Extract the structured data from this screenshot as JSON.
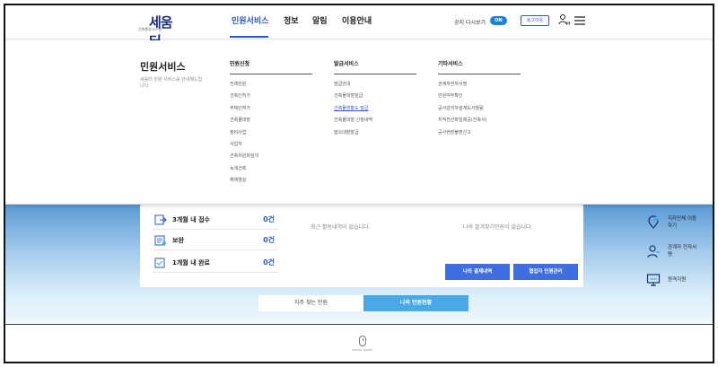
{
  "header": {
    "logo_text": "세움터",
    "logo_sub": "건축행정시스템",
    "nav": [
      {
        "label": "민원서비스",
        "active": true
      },
      {
        "label": "정보",
        "active": false
      },
      {
        "label": "알림",
        "active": false
      },
      {
        "label": "이용안내",
        "active": false
      }
    ],
    "notice_label": "공지 다시보기",
    "notice_toggle": "ON",
    "login_label": "로그아웃",
    "accent_color": "#2b57c7"
  },
  "mega": {
    "title": "민원서비스",
    "desc": "세움터 민원 서비스를 안내해드립니다.",
    "columns": [
      {
        "head": "민원신청",
        "items": [
          "전체민원",
          "건축인허가",
          "주택인허가",
          "건축물대장",
          "정비사업",
          "사업자",
          "건축위원회심의",
          "녹색건축",
          "해체멸실"
        ]
      },
      {
        "head": "발급서비스",
        "items": [
          "발급안내",
          "건축물대장발급",
          "건축물현황도 발급",
          "건축물대장 신청내역",
          "말소대장발급"
        ],
        "selected": 2
      },
      {
        "head": "기타서비스",
        "items": [
          "관계자전자서명",
          "민원여부확인",
          "공사감리자설계도서열람",
          "지적전산파일제공(건축사)",
          "공사현장불편신고"
        ]
      }
    ]
  },
  "status": {
    "rows": [
      {
        "label": "3개월 내 접수",
        "count": "0건"
      },
      {
        "label": "보완",
        "count": "0건"
      },
      {
        "label": "1개월 내 완료",
        "count": "0건"
      }
    ],
    "recent_empty": "최근 활동내역이 없습니다.",
    "favorite_empty": "나의 즐겨찾기민원이 없습니다.",
    "btn_payments": "나의 결제내역",
    "btn_agency": "협업자 민원관리"
  },
  "side": [
    {
      "label": "지자단체 이동하기",
      "icon": "location-pin-icon"
    },
    {
      "label": "관계자 전자서명",
      "icon": "person-sign-icon"
    },
    {
      "label": "원격지원",
      "icon": "remote-monitor-icon"
    }
  ],
  "tabs": [
    {
      "label": "자주 찾는 민원",
      "active": false
    },
    {
      "label": "나의 민원현황",
      "active": true
    }
  ],
  "scroll_label": "SCROLL DOWN"
}
